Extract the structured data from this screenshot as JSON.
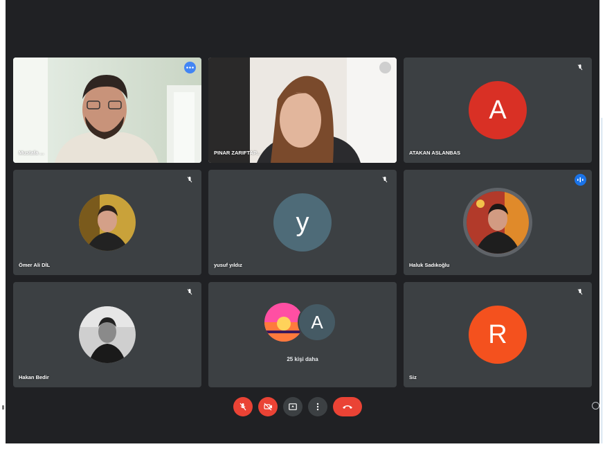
{
  "participants": [
    {
      "name": "Mustafa ..."
    },
    {
      "name": "PINAR ZARIFTAP..."
    },
    {
      "name": "ATAKAN ASLANBAS",
      "initial": "A",
      "color": "#d93025"
    },
    {
      "name": "Ömer Ali DİL"
    },
    {
      "name": "yusuf yıldız",
      "initial": "y",
      "color": "#4e6b78"
    },
    {
      "name": "Haluk Sadıkoğlu"
    },
    {
      "name": "Hakan Bedir"
    },
    {
      "more_label": "25 kişi daha",
      "initial": "A"
    },
    {
      "name": "Siz",
      "initial": "R",
      "color": "#f4511e"
    }
  ],
  "controls": {
    "mic": "mic-off-icon",
    "camera": "camera-off-icon",
    "present": "present-screen-icon",
    "more": "more-options-icon",
    "end": "end-call-icon"
  },
  "colors": {
    "accent": "#4285f4",
    "danger": "#ea4335",
    "tile": "#3c4043",
    "background": "#202124"
  }
}
